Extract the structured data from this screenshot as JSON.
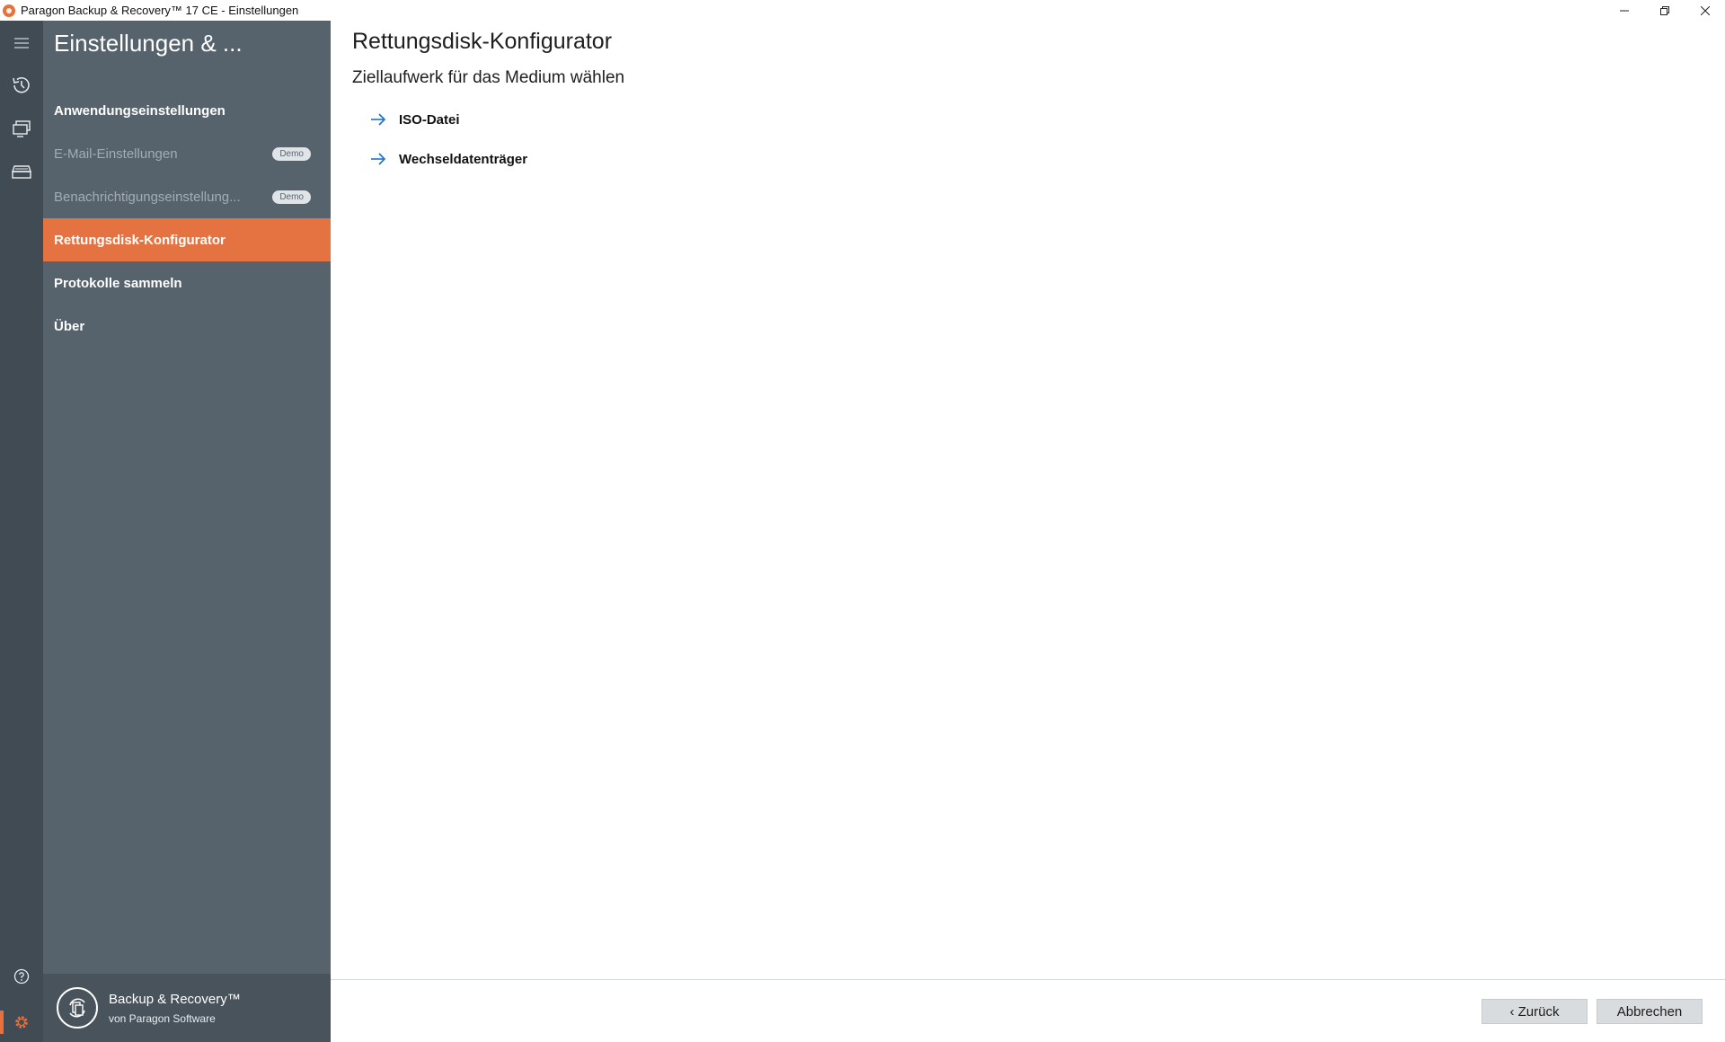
{
  "window": {
    "title": "Paragon Backup & Recovery™ 17 CE - Einstellungen"
  },
  "rail": {
    "items": [
      {
        "icon": "hamburger-menu-icon"
      },
      {
        "icon": "history-clock-icon"
      },
      {
        "icon": "monitors-icon"
      },
      {
        "icon": "drive-stack-icon"
      },
      {
        "icon": "help-icon"
      },
      {
        "icon": "gear-icon"
      }
    ],
    "accent_color": "#e8703a"
  },
  "sidebar": {
    "title": "Einstellungen & ...",
    "items": [
      {
        "label": "Anwendungseinstellungen",
        "state": "normal"
      },
      {
        "label": "E-Mail-Einstellungen",
        "state": "disabled",
        "badge": "Demo"
      },
      {
        "label": "Benachrichtigungseinstellung...",
        "state": "disabled",
        "badge": "Demo"
      },
      {
        "label": "Rettungsdisk-Konfigurator",
        "state": "active"
      },
      {
        "label": "Protokolle sammeln",
        "state": "normal"
      },
      {
        "label": "Über",
        "state": "normal"
      }
    ],
    "footer": {
      "name": "Backup & Recovery™",
      "sub": "von Paragon Software"
    }
  },
  "main": {
    "title": "Rettungsdisk-Konfigurator",
    "subtitle": "Ziellaufwerk für das Medium wählen",
    "options": [
      {
        "label": "ISO-Datei",
        "icon": "arrow-right-icon"
      },
      {
        "label": "Wechseldatenträger",
        "icon": "arrow-right-icon"
      }
    ],
    "buttons": {
      "back": "‹ Zurück",
      "cancel": "Abbrechen"
    },
    "link_color": "#1a73c8"
  }
}
